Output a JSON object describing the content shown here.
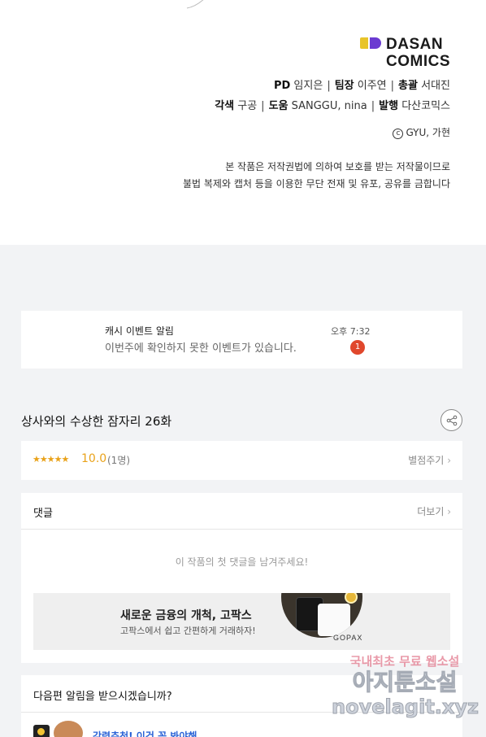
{
  "credits": {
    "logo_line1": "DASAN",
    "logo_line2": "COMICS",
    "pd_role": "PD",
    "pd_name": "임지은",
    "lead_role": "팀장",
    "lead_name": "이주연",
    "chief_role": "총괄",
    "chief_name": "서대진",
    "adapt_role": "각색",
    "adapt_name": "구공",
    "assist_role": "도움",
    "assist_name": "SANGGU, nina",
    "publish_role": "발행",
    "publish_name": "다산코믹스",
    "separator": "|",
    "copyright_symbol": "c",
    "copyright": "GYU, 가현",
    "notice_line1": "본 작품은 저작권법에 의하여 보호를 받는 저작물이므로",
    "notice_line2": "불법 복제와 캡처 등을 이용한 무단 전재 및 유포, 공유를 금합니다"
  },
  "cash_event": {
    "title": "캐시 이벤트 알림",
    "description": "이번주에 확인하지 못한 이벤트가 있습니다.",
    "time": "오후 7:32",
    "badge_count": "1"
  },
  "episode": {
    "title": "상사와의 수상한 잠자리 26화"
  },
  "rating": {
    "stars": "★★★★★",
    "score": "10.0",
    "raters": "(1명)",
    "rate_label": "별점주기",
    "star_fill": 1.0
  },
  "comments": {
    "title": "댓글",
    "more_label": "더보기",
    "empty_message": "이 작품의 첫 댓글을 남겨주세요!"
  },
  "ad": {
    "title": "새로운 금융의 개척, 고팍스",
    "subtitle": "고팍스에서 쉽고 간편하게 거래하자!",
    "brand": "GOPAX"
  },
  "next_episode": {
    "question": "다음편 알림을 받으시겠습니까?",
    "link_text": "강력추천! 이건 꼭 봐야해"
  },
  "watermark": {
    "line1": "국내최초 무료 웹소설",
    "line2": "아지툰소설",
    "line3": "novelagit.xyz"
  },
  "colors": {
    "accent": "#e9a21a",
    "badge": "#e0472c",
    "link": "#2a62d6",
    "logo_yellow": "#e8c42a",
    "logo_purple": "#6b3bd1"
  },
  "icons": {
    "share": "share-icon",
    "chevron": "chevron-right-icon"
  }
}
